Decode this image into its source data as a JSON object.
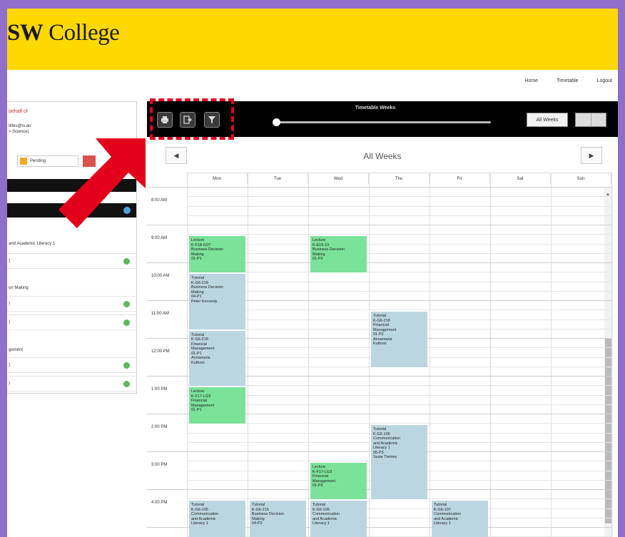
{
  "header": {
    "logo_bold": "SW",
    "logo_rest": " College"
  },
  "topnav": [
    "Home",
    "Timetable",
    "Logout"
  ],
  "left_panel": {
    "behalf": "behalf of",
    "school": "titles@ts.au\n> Science)",
    "pending_label": "Pending",
    "groups": [
      {
        "title": "and Academic Literacy 1",
        "rows": [
          ")"
        ]
      },
      {
        "title": "on Making",
        "rows": [
          ")",
          ")"
        ]
      },
      {
        "title": "gement",
        "rows": [
          ")",
          ")"
        ]
      }
    ]
  },
  "toolbar": {
    "title": "Timetable Weeks",
    "all_weeks_button": "All Weeks",
    "print_icon": "print-icon",
    "export_icon": "export-icon",
    "filter_icon": "filter-icon"
  },
  "nav": {
    "prev": "◀",
    "next": "▶",
    "week_label": "All Weeks"
  },
  "days": [
    "Mon",
    "Tue",
    "Wed",
    "Thu",
    "Fri",
    "Sat",
    "Sun"
  ],
  "times": [
    "8:00 AM",
    "9:00 AM",
    "10:00 AM",
    "11:00 AM",
    "12:00 PM",
    "1:00 PM",
    "2:00 PM",
    "3:00 PM",
    "4:00 PM"
  ],
  "events": [
    {
      "day": 0,
      "start": 9.0,
      "dur": 1.0,
      "kind": "lecture",
      "text": "Lecture\nK-F18-G07\nBusiness Decision\nMaking\n01-P1"
    },
    {
      "day": 2,
      "start": 9.0,
      "dur": 1.0,
      "kind": "lecture",
      "text": "Lecture\nK-E19-10\nBusiness Decision\nMaking\n01-P2"
    },
    {
      "day": 0,
      "start": 10.0,
      "dur": 1.5,
      "kind": "tutorial",
      "text": "Tutorial\nK-G6-218\nBusiness Decision\nMaking\n04-P1\nPeter Kennedy"
    },
    {
      "day": 3,
      "start": 11.0,
      "dur": 1.5,
      "kind": "tutorial",
      "text": "Tutorial\nK-G6-218\nFinancial\nManagement\n01-P2\nAnnamaria\nKuthoni"
    },
    {
      "day": 0,
      "start": 11.5,
      "dur": 1.5,
      "kind": "tutorial",
      "text": "Tutorial\nK-G6-218\nFinancial\nManagement\n01-P1\nAnnamaria\nKuthoni"
    },
    {
      "day": 0,
      "start": 13.0,
      "dur": 1.0,
      "kind": "lecture",
      "text": "Lecture\nK-F17-LG3\nFinancial\nManagement\n01-P1"
    },
    {
      "day": 3,
      "start": 14.0,
      "dur": 2.0,
      "kind": "tutorial",
      "text": "Tutorial\nK-G6-106\nCommunication\nand Academic\nLiteracy 1\n05-P3\nSusie Tierney"
    },
    {
      "day": 2,
      "start": 15.0,
      "dur": 1.0,
      "kind": "lecture",
      "text": "Lecture\nK-F17-LG3\nFinancial\nManagement\n01-P2"
    },
    {
      "day": 0,
      "start": 16.0,
      "dur": 1.0,
      "kind": "tutorial",
      "text": "Tutorial\nK-G6-105\nCommunication\nand Academic\nLiteracy 1"
    },
    {
      "day": 1,
      "start": 16.0,
      "dur": 1.0,
      "kind": "tutorial",
      "text": "Tutorial\nK-G6-215\nBusiness Decision\nMaking\n04-P2"
    },
    {
      "day": 2,
      "start": 16.0,
      "dur": 1.0,
      "kind": "tutorial",
      "text": "Tutorial\nK-G6-106\nCommunication\nand Academic\nLiteracy 1"
    },
    {
      "day": 4,
      "start": 16.0,
      "dur": 1.0,
      "kind": "tutorial",
      "text": "Tutorial\nK-G6-107\nCommunication\nand Academic\nLiteracy 1"
    }
  ],
  "colors": {
    "banner": "#ffd800",
    "lecture": "#7be29a",
    "tutorial": "#bcd6e1",
    "highlight": "#e3001b"
  }
}
